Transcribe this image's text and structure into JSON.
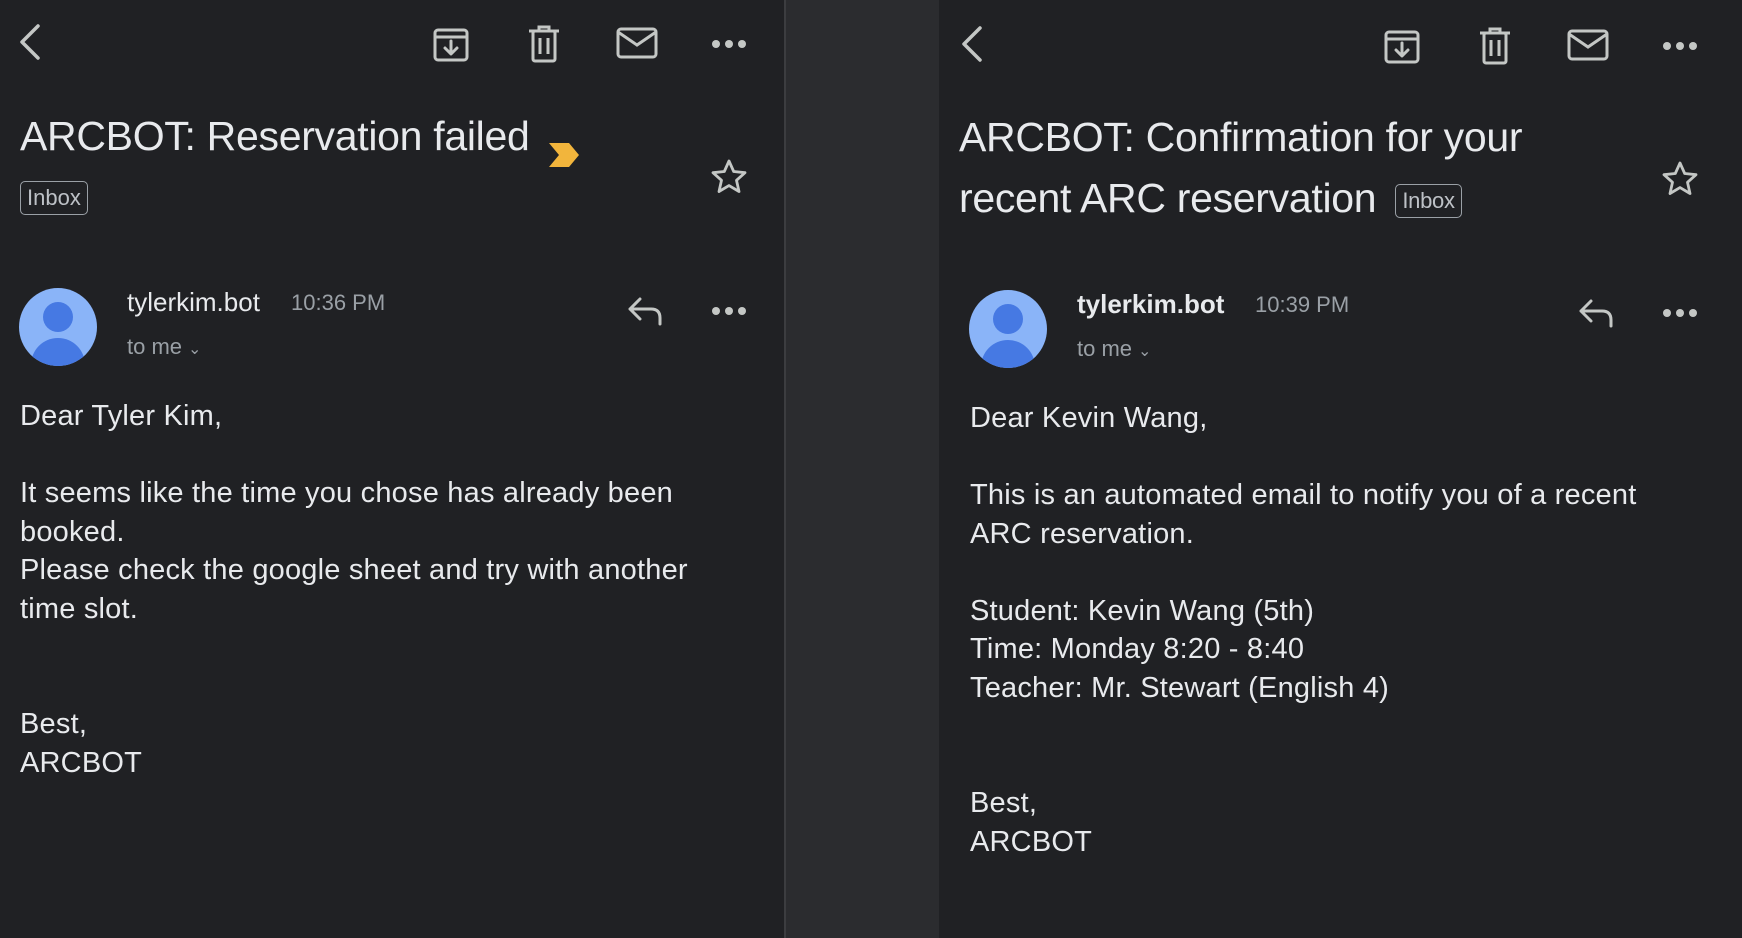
{
  "left": {
    "toolbar": {
      "back_icon": "back-arrow-icon",
      "archive_icon": "archive-icon",
      "delete_icon": "trash-icon",
      "mark_unread_icon": "mail-icon",
      "more_icon": "more-horizontal-icon"
    },
    "subject": "ARCBOT: Reservation failed",
    "label": "Inbox",
    "sender": {
      "name": "tylerkim.bot",
      "time": "10:36 PM",
      "recipient": "to me"
    },
    "body": {
      "greeting": "Dear Tyler Kim,",
      "line1": "It seems like the time you chose has already been",
      "line2": "booked.",
      "line3": "Please check the google sheet and try with another",
      "line4": "time slot.",
      "signoff": "Best,",
      "signature": "ARCBOT"
    }
  },
  "right": {
    "toolbar": {
      "back_icon": "back-arrow-icon",
      "archive_icon": "archive-icon",
      "delete_icon": "trash-icon",
      "mark_unread_icon": "mail-icon",
      "more_icon": "more-horizontal-icon"
    },
    "subject_line1": "ARCBOT: Confirmation for your",
    "subject_line2": "recent ARC reservation",
    "label": "Inbox",
    "sender": {
      "name": "tylerkim.bot",
      "time": "10:39 PM",
      "recipient": "to me"
    },
    "body": {
      "greeting": "Dear Kevin Wang,",
      "line1": "This is an automated email to notify you of a recent",
      "line2": "ARC reservation.",
      "student": "Student: Kevin Wang (5th)",
      "time": "Time: Monday 8:20 - 8:40",
      "teacher": "Teacher: Mr. Stewart (English 4)",
      "signoff": "Best,",
      "signature": "ARCBOT"
    }
  },
  "colors": {
    "background": "#202124",
    "text": "#e8eaed",
    "muted": "#9aa0a6",
    "important_marker": "#f2b53c",
    "avatar_bg": "#8ab4f8",
    "avatar_fg": "#4679e3"
  }
}
